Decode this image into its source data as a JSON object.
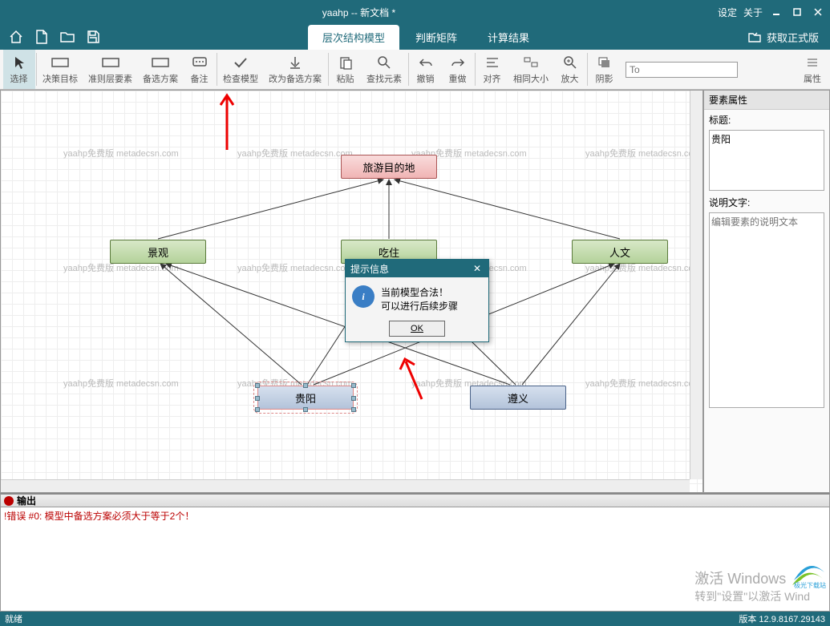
{
  "titlebar": {
    "title": "yaahp -- 新文档 *",
    "settings": "设定",
    "about": "关于"
  },
  "main_tabs": {
    "t0": "层次结构模型",
    "t1": "判断矩阵",
    "t2": "计算结果"
  },
  "get_full": "获取正式版",
  "ribbon": {
    "select": "选择",
    "goal": "决策目标",
    "criteria": "准则层要素",
    "alt": "备选方案",
    "note": "备注",
    "check": "检查模型",
    "layout": "改为备选方案",
    "paste": "粘贴",
    "find": "查找元素",
    "undo": "撤销",
    "redo": "重做",
    "align": "对齐",
    "samesize": "相同大小",
    "zoom": "放大",
    "shadow": "阴影",
    "to_placeholder": "To",
    "props": "属性"
  },
  "nodes": {
    "goal": "旅游目的地",
    "c0": "景观",
    "c1": "吃住",
    "c2": "人文",
    "a0": "贵阳",
    "a1": "遵义"
  },
  "watermark": "yaahp免费版 metadecsn.com",
  "dialog": {
    "title": "提示信息",
    "line1": "当前模型合法！",
    "line2": "可以进行后续步骤",
    "ok": "OK"
  },
  "rpanel": {
    "header": "要素属性",
    "title_label": "标题:",
    "title_value": "贵阳",
    "desc_label": "说明文字:",
    "desc_placeholder": "编辑要素的说明文本"
  },
  "output": {
    "header": "输出",
    "line": "!错误 #0:   模型中备选方案必须大于等于2个！"
  },
  "activate": {
    "l1": "激活 Windows",
    "l2": "转到\"设置\"以激活 Wind"
  },
  "logo_text": "极光下载站",
  "status": {
    "ready": "就绪",
    "version": "版本 12.9.8167.29143"
  }
}
